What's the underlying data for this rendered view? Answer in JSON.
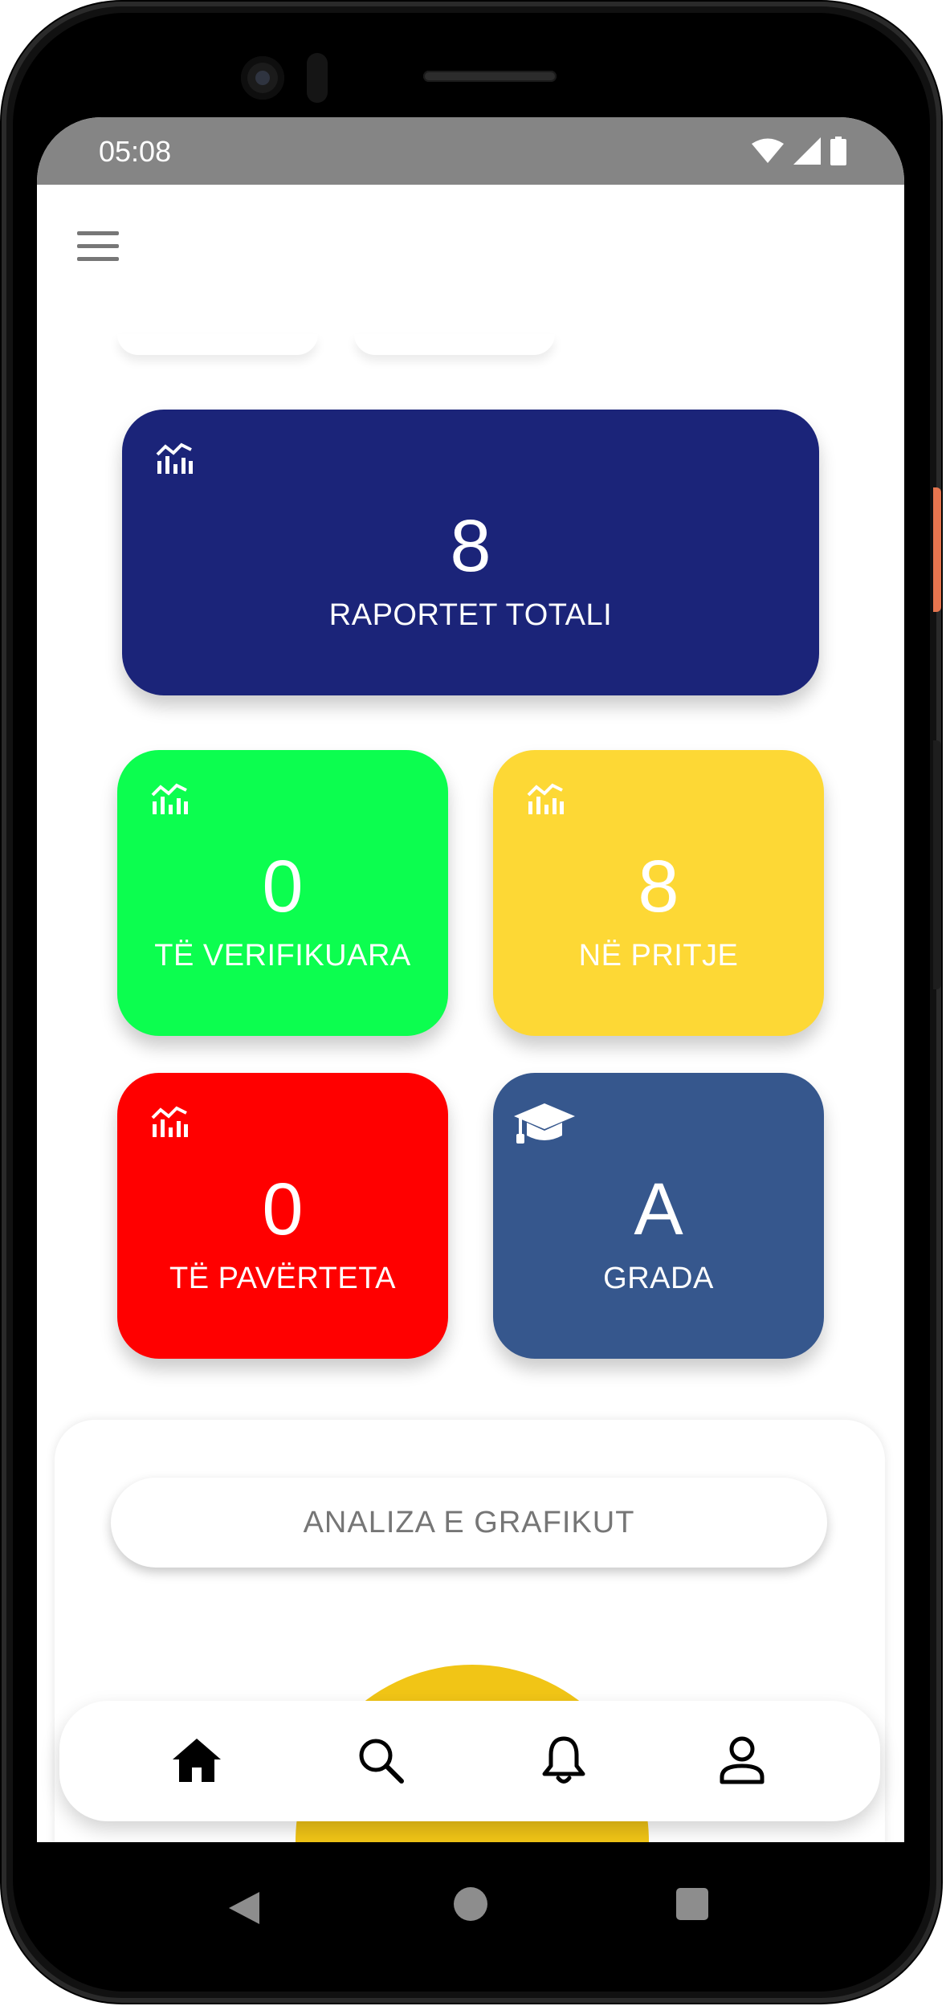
{
  "status_bar": {
    "time": "05:08"
  },
  "cards": {
    "total": {
      "value": "8",
      "label": "RAPORTET TOTALI",
      "color": "#1b2479",
      "icon": "bar-chart-icon"
    },
    "verified": {
      "value": "0",
      "label": "TË VERIFIKUARA",
      "color": "#0cfe4f",
      "icon": "bar-chart-icon"
    },
    "pending": {
      "value": "8",
      "label": "NË PRITJE",
      "color": "#fdd835",
      "icon": "bar-chart-icon"
    },
    "false": {
      "value": "0",
      "label": "TË PAVËRTETA",
      "color": "#ff0000",
      "icon": "bar-chart-icon"
    },
    "grade": {
      "value": "A",
      "label": "GRADA",
      "color": "#36578d",
      "icon": "graduation-cap-icon"
    }
  },
  "analysis": {
    "button_label": "ANALIZA E GRAFIKUT",
    "gauge_color": "#f1c516"
  },
  "bottom_nav": {
    "items": [
      {
        "icon": "home-icon"
      },
      {
        "icon": "search-icon"
      },
      {
        "icon": "bell-icon"
      },
      {
        "icon": "user-icon"
      }
    ]
  }
}
